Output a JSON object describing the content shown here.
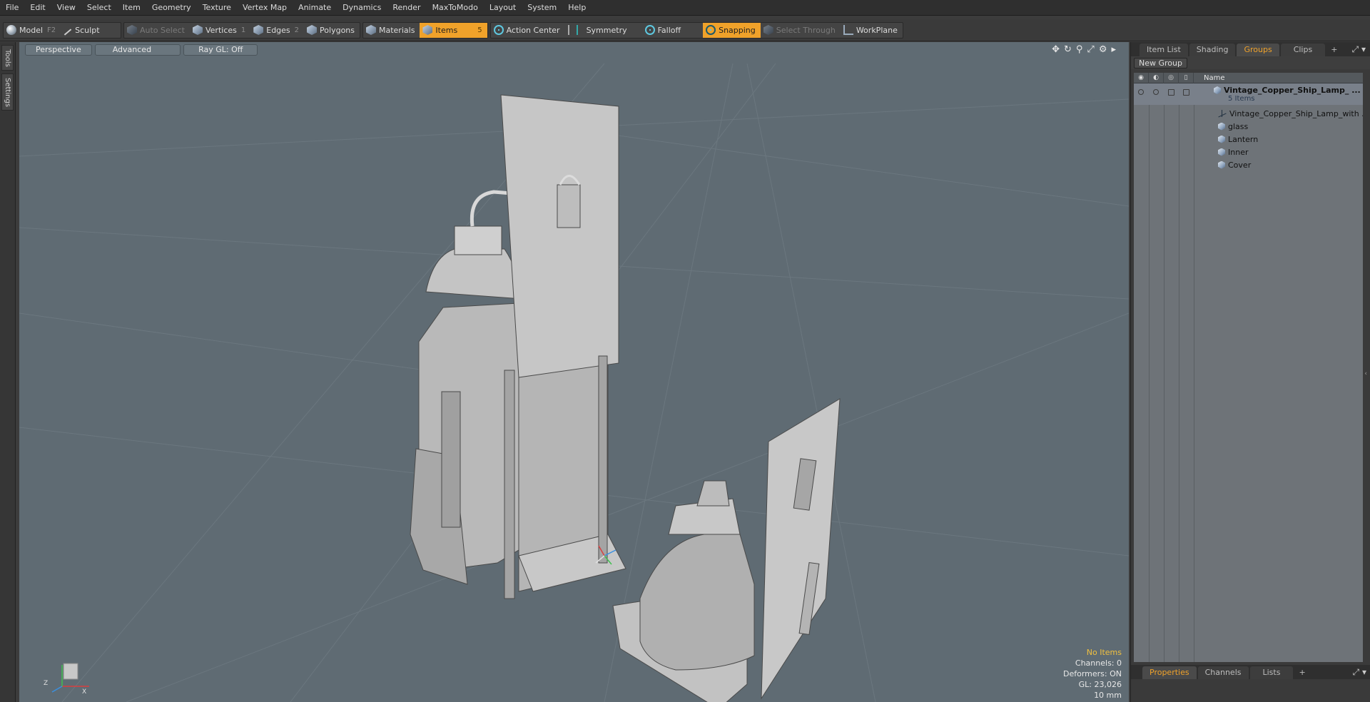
{
  "menu": [
    "File",
    "Edit",
    "View",
    "Select",
    "Item",
    "Geometry",
    "Texture",
    "Vertex Map",
    "Animate",
    "Dynamics",
    "Render",
    "MaxToModo",
    "Layout",
    "System",
    "Help"
  ],
  "toolbar": {
    "model": "Model",
    "model_key": "F2",
    "sculpt": "Sculpt",
    "auto_select": "Auto Select",
    "vertices": "Vertices",
    "vertices_key": "1",
    "edges": "Edges",
    "edges_key": "2",
    "polygons": "Polygons",
    "materials": "Materials",
    "items": "Items",
    "items_key": "5",
    "action_center": "Action Center",
    "symmetry": "Symmetry",
    "falloff": "Falloff",
    "snapping": "Snapping",
    "select_through": "Select Through",
    "workplane": "WorkPlane"
  },
  "left_tabs": [
    "Tools",
    "Settings"
  ],
  "viewport": {
    "view": "Perspective",
    "shading": "Advanced",
    "raygl": "Ray GL: Off",
    "stats": {
      "selection": "No Items",
      "channels": "Channels: 0",
      "deformers": "Deformers: ON",
      "gl": "GL: 23,026",
      "unit": "10 mm"
    },
    "axis_labels": {
      "x": "X",
      "z": "Z"
    }
  },
  "right_panel": {
    "tabs": [
      "Item List",
      "Shading",
      "Groups",
      "Clips"
    ],
    "active_tab": "Groups",
    "new_group": "New Group",
    "name_header": "Name",
    "root": {
      "name": "Vintage_Copper_Ship_Lamp_ ...",
      "count": "5 Items"
    },
    "children": [
      {
        "name": "Vintage_Copper_Ship_Lamp_with ...",
        "icon": "locator-icon"
      },
      {
        "name": "glass",
        "icon": "mesh-icon"
      },
      {
        "name": "Lantern",
        "icon": "mesh-icon"
      },
      {
        "name": "Inner",
        "icon": "mesh-icon"
      },
      {
        "name": "Cover",
        "icon": "mesh-icon"
      }
    ],
    "bottom_tabs": [
      "Properties",
      "Channels",
      "Lists"
    ],
    "bottom_active": "Properties"
  },
  "colors": {
    "accent": "#f0a22a",
    "viewport_bg": "#5f6b73",
    "panel_bg": "#3a3a3a"
  }
}
